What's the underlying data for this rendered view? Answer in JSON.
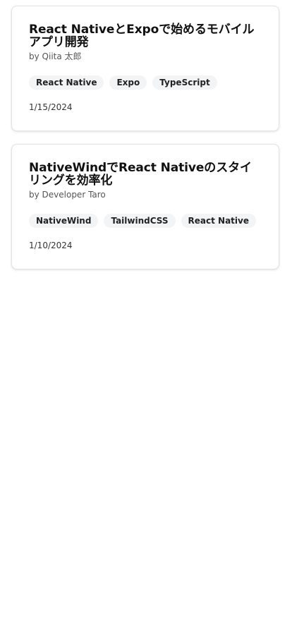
{
  "articles": [
    {
      "title": "React NativeとExpoで始めるモバイルアプリ開発",
      "author": "by Qiita 太郎",
      "tags": [
        "React Native",
        "Expo",
        "TypeScript"
      ],
      "date": "1/15/2024"
    },
    {
      "title": "NativeWindでReact Nativeのスタイリングを効率化",
      "author": "by Developer Taro",
      "tags": [
        "NativeWind",
        "TailwindCSS",
        "React Native"
      ],
      "date": "1/10/2024"
    }
  ]
}
